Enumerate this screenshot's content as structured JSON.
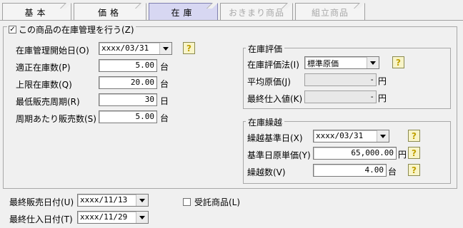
{
  "tabs": [
    {
      "label": "基本"
    },
    {
      "label": "価格"
    },
    {
      "label": "在庫"
    },
    {
      "label": "おきまり商品"
    },
    {
      "label": "組立商品"
    }
  ],
  "manage_stock": {
    "label": "この商品の在庫管理を行う(Z)",
    "checked": "✓"
  },
  "left": {
    "start_date_label": "在庫管理開始日(O)",
    "start_date_value": "xxxx/03/31",
    "proper_stock_label": "適正在庫数(P)",
    "proper_stock_value": "5.00",
    "proper_stock_unit": "台",
    "max_stock_label": "上限在庫数(Q)",
    "max_stock_value": "20.00",
    "max_stock_unit": "台",
    "min_cycle_label": "最低販売周期(R)",
    "min_cycle_value": "30",
    "min_cycle_unit": "日",
    "per_cycle_label": "周期あたり販売数(S)",
    "per_cycle_value": "5.00",
    "per_cycle_unit": "台"
  },
  "valuation": {
    "title": "在庫評価",
    "method_label": "在庫評価法(I)",
    "method_value": "標準原価",
    "avg_cost_label": "平均原価(J)",
    "avg_cost_value": "-",
    "avg_cost_unit": "円",
    "last_purchase_label": "最終仕入値(K)",
    "last_purchase_value": "-",
    "last_purchase_unit": "円"
  },
  "carryover": {
    "title": "在庫繰越",
    "base_date_label": "繰越基準日(X)",
    "base_date_value": "xxxx/03/31",
    "unit_cost_label": "基準日原単価(Y)",
    "unit_cost_value": "65,000.00",
    "unit_cost_unit": "円",
    "qty_label": "繰越数(V)",
    "qty_value": "4.00",
    "qty_unit": "台"
  },
  "bottom": {
    "last_sale_label": "最終販売日付(U)",
    "last_sale_value": "xxxx/11/13",
    "last_purchase_date_label": "最終仕入日付(T)",
    "last_purchase_date_value": "xxxx/11/29",
    "consignment_label": "受託商品(L)"
  },
  "help_icon": "?"
}
